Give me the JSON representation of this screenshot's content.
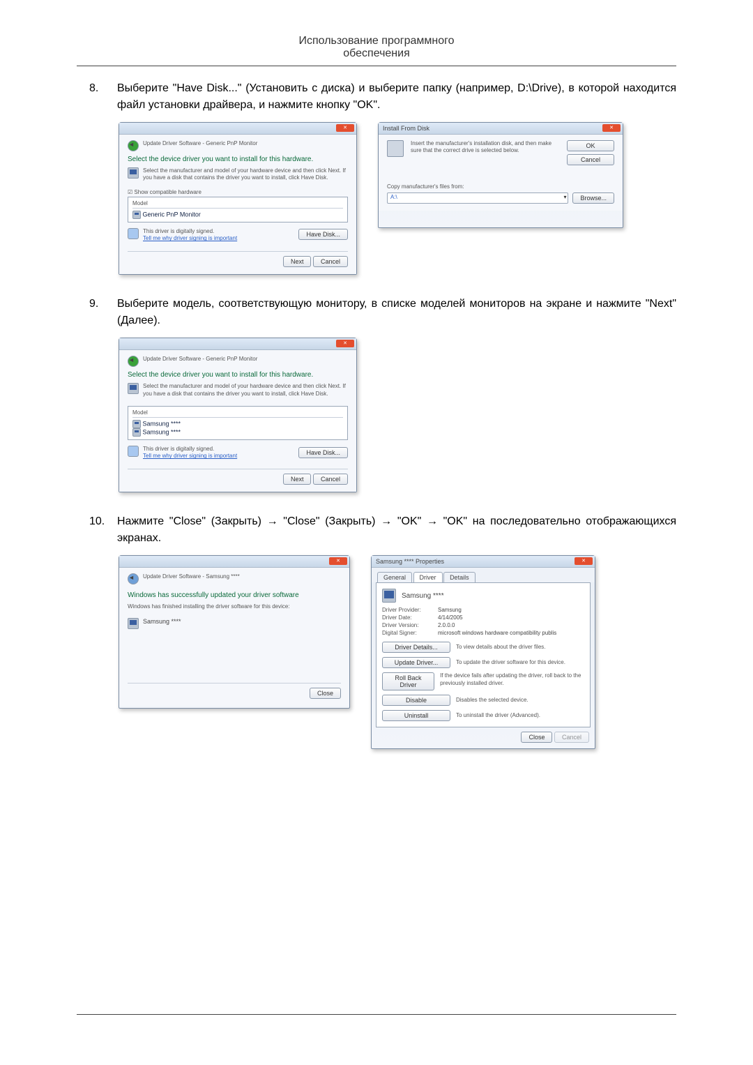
{
  "header": {
    "line1": "Использование программного",
    "line2": "обеспечения"
  },
  "steps": {
    "s8": {
      "num": "8.",
      "text": "Выберите \"Have Disk...\" (Установить с диска) и выберите папку (например, D:\\Drive), в которой находится файл установки драйвера, и нажмите кнопку \"OK\"."
    },
    "s9": {
      "num": "9.",
      "text": "Выберите модель, соответствующую монитору, в списке моделей мониторов на экране и нажмите \"Next\" (Далее)."
    },
    "s10": {
      "num": "10.",
      "text": "Нажмите \"Close\" (Закрыть) → \"Close\" (Закрыть) → \"OK\" → \"OK\" на последовательно отображающихся экранах."
    }
  },
  "dlg1": {
    "breadcrumb": "Update Driver Software - Generic PnP Monitor",
    "title": "Select the device driver you want to install for this hardware.",
    "desc": "Select the manufacturer and model of your hardware device and then click Next. If you have a disk that contains the driver you want to install, click Have Disk.",
    "showcompat": "Show compatible hardware",
    "model_hdr": "Model",
    "model_item": "Generic PnP Monitor",
    "signed": "This driver is digitally signed.",
    "tellme": "Tell me why driver signing is important",
    "havedisk": "Have Disk...",
    "next": "Next",
    "cancel": "Cancel"
  },
  "dlg2": {
    "title": "Install From Disk",
    "desc": "Insert the manufacturer's installation disk, and then make sure that the correct drive is selected below.",
    "ok": "OK",
    "cancel": "Cancel",
    "copy": "Copy manufacturer's files from:",
    "drive": "A:\\",
    "browse": "Browse..."
  },
  "dlg3": {
    "breadcrumb": "Update Driver Software - Generic PnP Monitor",
    "title": "Select the device driver you want to install for this hardware.",
    "desc": "Select the manufacturer and model of your hardware device and then click Next. If you have a disk that contains the driver you want to install, click Have Disk.",
    "model_hdr": "Model",
    "model_a": "Samsung ****",
    "model_b": "Samsung ****",
    "signed": "This driver is digitally signed.",
    "tellme": "Tell me why driver signing is important",
    "havedisk": "Have Disk...",
    "next": "Next",
    "cancel": "Cancel"
  },
  "dlg4": {
    "breadcrumb": "Update Driver Software - Samsung ****",
    "title": "Windows has successfully updated your driver software",
    "desc": "Windows has finished installing the driver software for this device:",
    "device": "Samsung ****",
    "close": "Close"
  },
  "dlg5": {
    "title": "Samsung **** Properties",
    "tab_general": "General",
    "tab_driver": "Driver",
    "tab_details": "Details",
    "device": "Samsung ****",
    "k_provider": "Driver Provider:",
    "v_provider": "Samsung",
    "k_date": "Driver Date:",
    "v_date": "4/14/2005",
    "k_version": "Driver Version:",
    "v_version": "2.0.0.0",
    "k_signer": "Digital Signer:",
    "v_signer": "microsoft windows hardware compatibility publisher",
    "btn_details": "Driver Details...",
    "txt_details": "To view details about the driver files.",
    "btn_update": "Update Driver...",
    "txt_update": "To update the driver software for this device.",
    "btn_rollback": "Roll Back Driver",
    "txt_rollback": "If the device fails after updating the driver, roll back to the previously installed driver.",
    "btn_disable": "Disable",
    "txt_disable": "Disables the selected device.",
    "btn_uninstall": "Uninstall",
    "txt_uninstall": "To uninstall the driver (Advanced).",
    "close": "Close",
    "cancel": "Cancel"
  }
}
